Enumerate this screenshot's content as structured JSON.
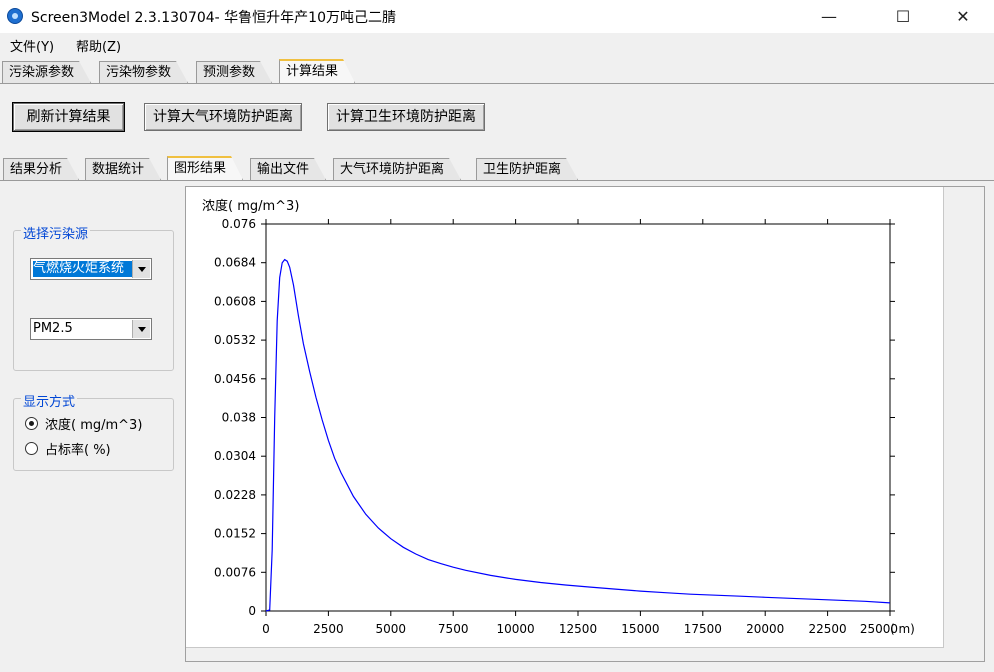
{
  "window": {
    "title": "Screen3Model 2.3.130704- 华鲁恒升年产10万吨己二腈",
    "minimize": "—",
    "maximize": "☐",
    "close": "✕"
  },
  "menu": [
    "文件(Y)",
    "帮助(Z)"
  ],
  "main_tabs": [
    "污染源参数",
    "污染物参数",
    "预测参数",
    "计算结果"
  ],
  "main_tab_active": "计算结果",
  "actions": {
    "refresh": "刷新计算结果",
    "atm_distance": "计算大气环境防护距离",
    "health_distance": "计算卫生环境防护距离"
  },
  "result_tabs": [
    "结果分析",
    "数据统计",
    "图形结果",
    "输出文件",
    "大气环境防护距离",
    "卫生防护距离"
  ],
  "result_tab_active": "图形结果",
  "source_group": {
    "label": "选择污染源",
    "source_value": "气燃烧火炬系统",
    "pollutant_value": "PM2.5"
  },
  "display_group": {
    "label": "显示方式",
    "options": [
      "浓度( mg/m^3)",
      "占标率( %)"
    ],
    "selected": 0
  },
  "chart_data": {
    "type": "line",
    "ylabel": "浓度( mg/m^3)",
    "xunit": "( m)",
    "xlim": [
      0,
      25000
    ],
    "ylim": [
      0,
      0.076
    ],
    "x_ticks": [
      0,
      2500,
      5000,
      7500,
      10000,
      12500,
      15000,
      17500,
      20000,
      22500,
      25000
    ],
    "y_ticks": [
      "0",
      "0.0076",
      "0.0152",
      "0.0228",
      "0.0304",
      "0.038",
      "0.0456",
      "0.0532",
      "0.0608",
      "0.0684",
      "0.076"
    ],
    "line_color": "#0000ff",
    "x": [
      0,
      150,
      250,
      350,
      450,
      550,
      650,
      750,
      850,
      950,
      1100,
      1300,
      1500,
      1750,
      2000,
      2250,
      2500,
      2750,
      3000,
      3500,
      4000,
      4500,
      5000,
      5500,
      6000,
      6500,
      7000,
      7500,
      8000,
      9000,
      10000,
      11000,
      12000,
      13000,
      14000,
      15000,
      16000,
      17000,
      18000,
      19000,
      20000,
      21000,
      22000,
      23000,
      24000,
      25000
    ],
    "y": [
      0,
      0.0002,
      0.012,
      0.038,
      0.057,
      0.0655,
      0.0684,
      0.069,
      0.0687,
      0.0675,
      0.064,
      0.058,
      0.0525,
      0.047,
      0.042,
      0.0375,
      0.0335,
      0.03,
      0.0272,
      0.0225,
      0.019,
      0.0163,
      0.0142,
      0.0125,
      0.0112,
      0.0101,
      0.0093,
      0.0086,
      0.008,
      0.007,
      0.0062,
      0.0056,
      0.0051,
      0.0047,
      0.0043,
      0.0039,
      0.0036,
      0.0033,
      0.0031,
      0.0029,
      0.0027,
      0.0025,
      0.0023,
      0.0021,
      0.0019,
      0.0016
    ]
  }
}
